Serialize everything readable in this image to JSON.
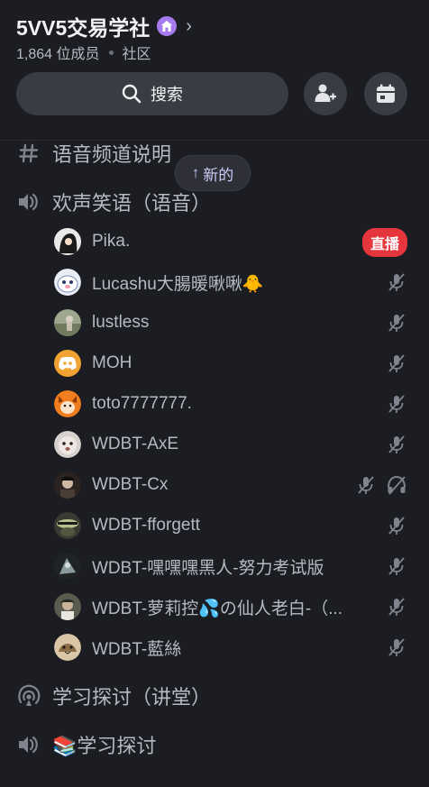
{
  "server": {
    "name": "5VV5交易学社",
    "member_count": "1,864 位成员",
    "type": "社区"
  },
  "search": {
    "label": "搜索"
  },
  "top_category": {
    "label": "语音频道说明"
  },
  "new_pill": {
    "label": "新的"
  },
  "voice_channel": {
    "label": "欢声笑语（语音）",
    "members": [
      {
        "name": "Pika.",
        "status": "live",
        "live_label": "直播"
      },
      {
        "name": "Lucashu大腸暖啾啾🐥",
        "status": "muted"
      },
      {
        "name": "lustless",
        "status": "muted"
      },
      {
        "name": "MOH",
        "status": "muted"
      },
      {
        "name": "toto7777777.",
        "status": "muted"
      },
      {
        "name": "WDBT-AxE",
        "status": "muted"
      },
      {
        "name": "WDBT-Cx",
        "status": "muted-deafened"
      },
      {
        "name": "WDBT-fforgett",
        "status": "muted"
      },
      {
        "name": "WDBT-嘿嘿嘿黑人-努力考试版",
        "status": "muted"
      },
      {
        "name": "WDBT-萝莉控💦の仙人老白-（...",
        "status": "muted"
      },
      {
        "name": "WDBT-藍絲",
        "status": "muted"
      }
    ]
  },
  "stage_channel": {
    "label": "学习探讨（讲堂）"
  },
  "voice_channel_2": {
    "label": "📚学习探讨"
  }
}
